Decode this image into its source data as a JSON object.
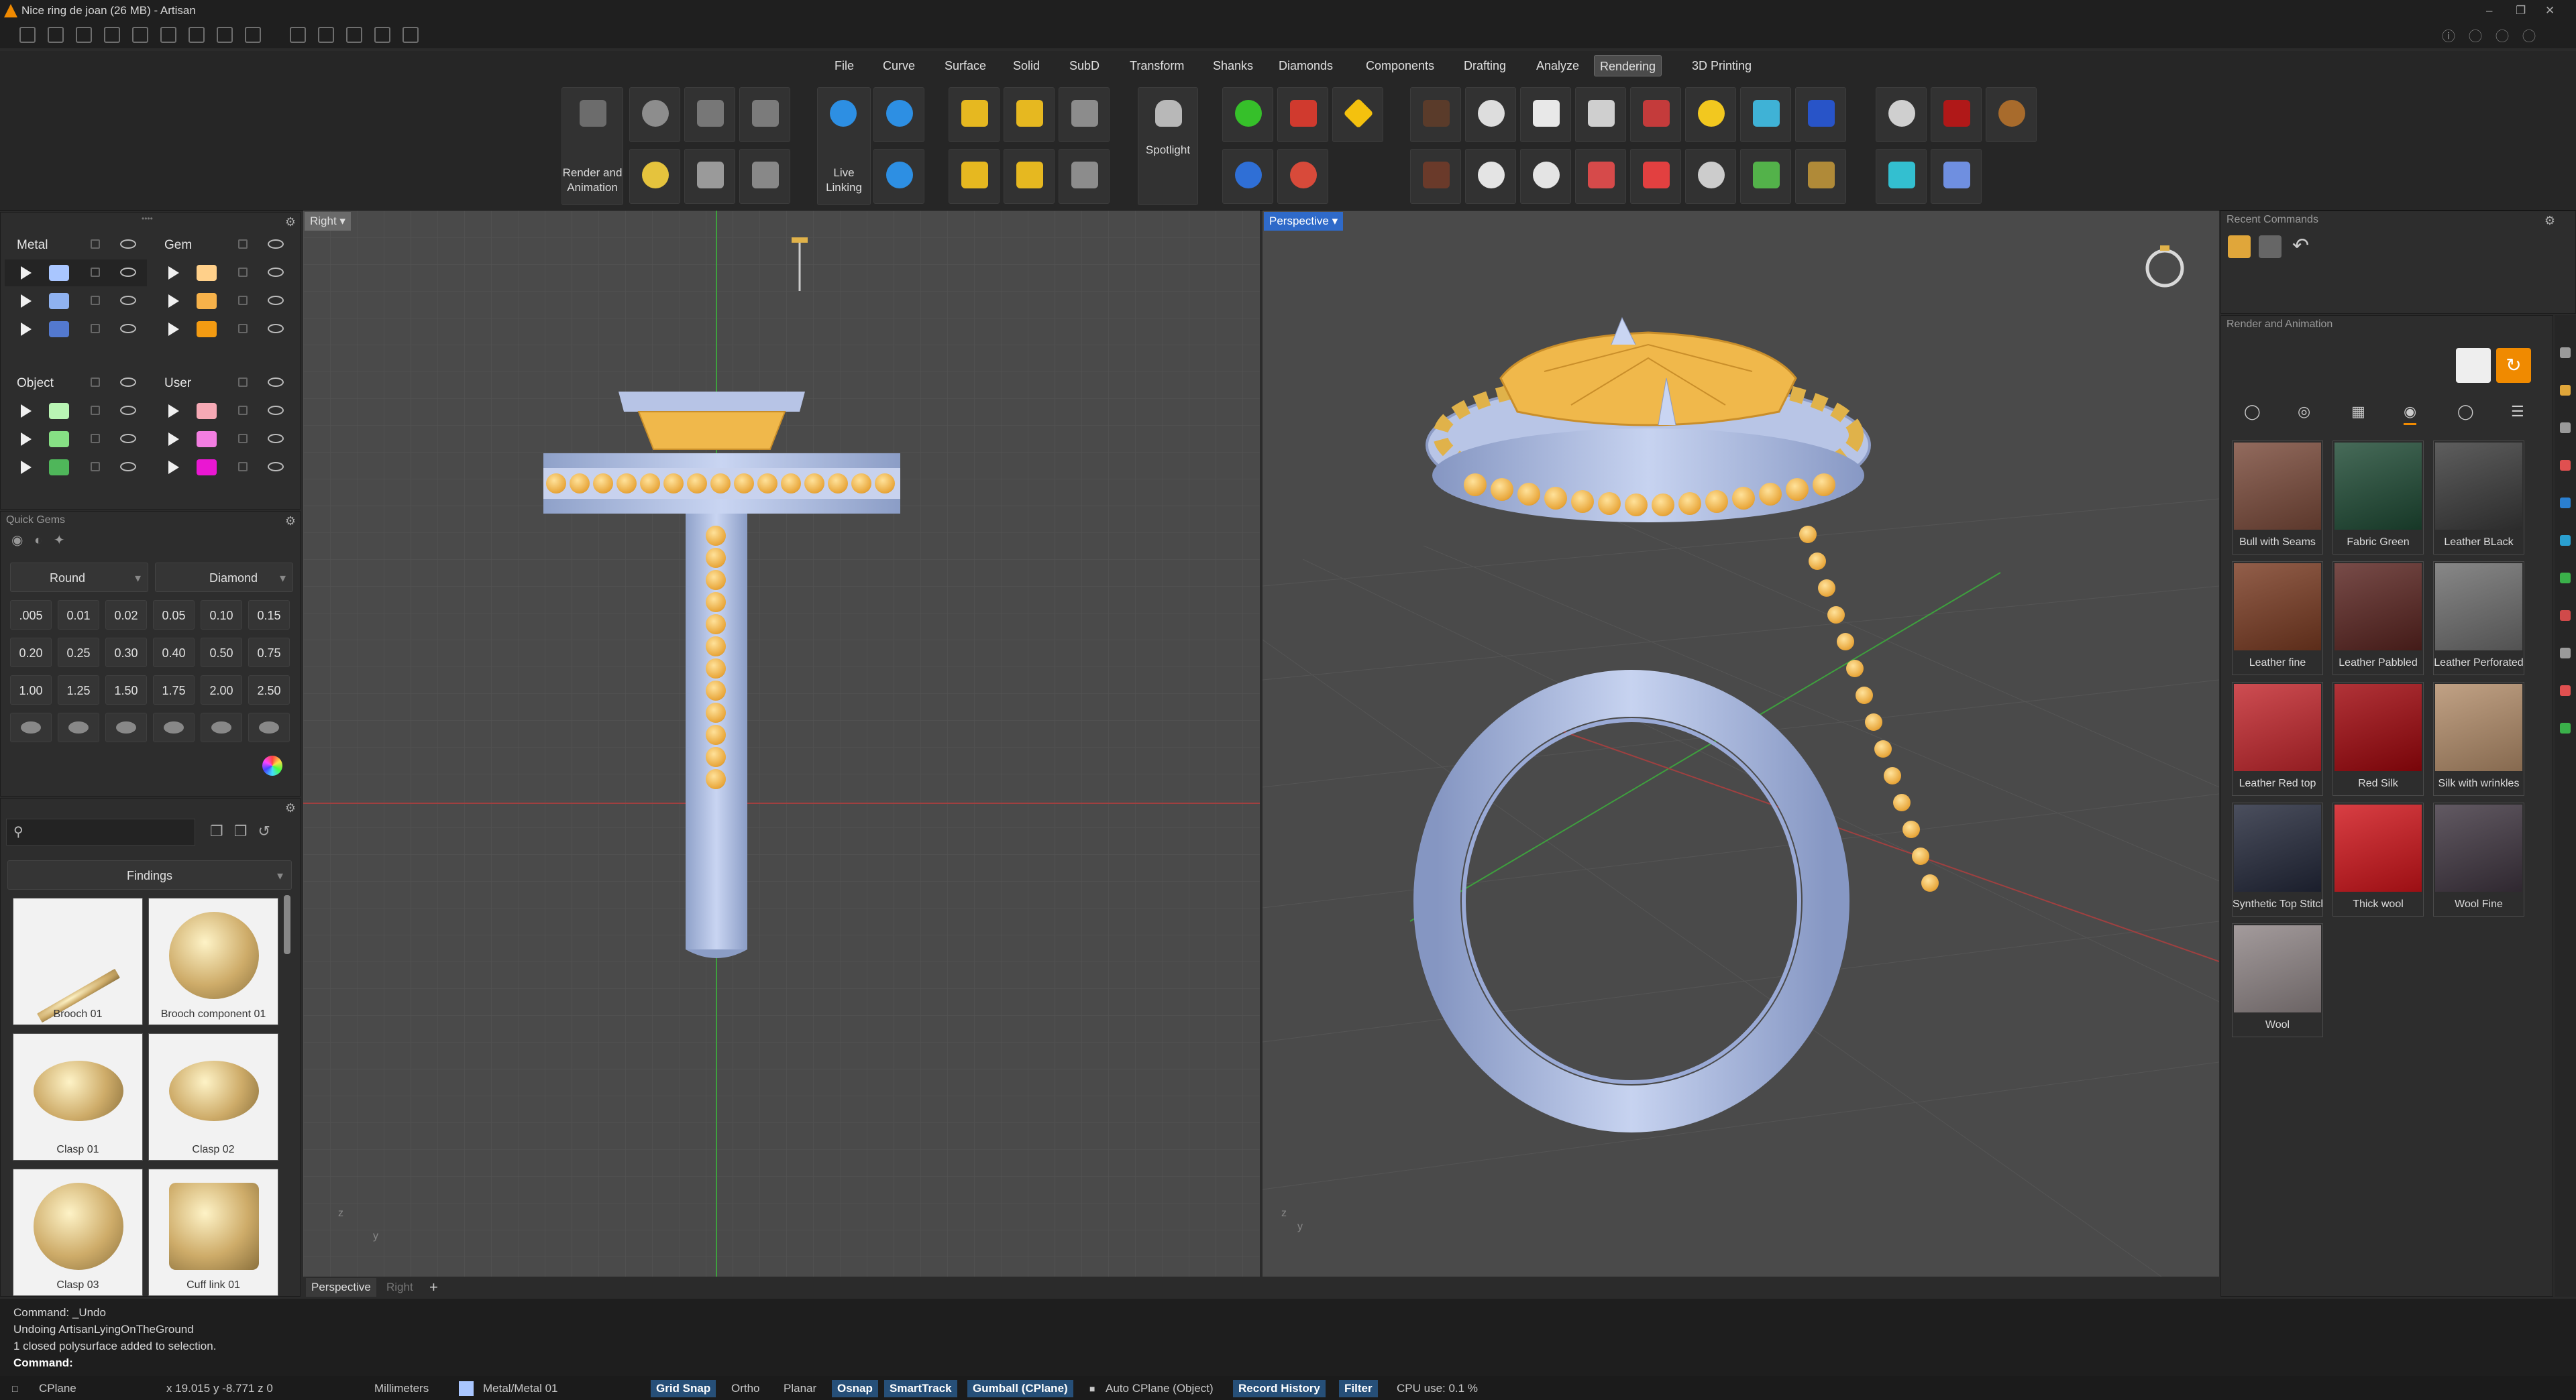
{
  "window": {
    "title": "Nice ring de joan (26 MB) - Artisan"
  },
  "menu": [
    "File",
    "Curve",
    "Surface",
    "Solid",
    "SubD",
    "Transform",
    "Shanks",
    "Diamonds",
    "Components",
    "Drafting",
    "Analyze",
    "Rendering",
    "3D Printing"
  ],
  "ribbon": {
    "render_label": "Render and Animation",
    "live_label": "Live Linking",
    "spot_label": "Spotlight"
  },
  "layers": {
    "metal": "Metal",
    "gem": "Gem",
    "object": "Object",
    "user": "User",
    "colors": {
      "metal": [
        "#a9c6ff",
        "#8fb2f0",
        "#5379cf"
      ],
      "gem": [
        "#ffd08a",
        "#f7b24a",
        "#f39b12"
      ],
      "object": [
        "#b9f5b4",
        "#86df84",
        "#4fb65a"
      ],
      "user": [
        "#f6a9b5",
        "#f27ee1",
        "#ea17d2"
      ]
    }
  },
  "quickgems": {
    "title": "Quick Gems",
    "shape": "Round",
    "material": "Diamond",
    "sizes": [
      ".005",
      "0.01",
      "0.02",
      "0.05",
      "0.10",
      "0.15",
      "0.20",
      "0.25",
      "0.30",
      "0.40",
      "0.50",
      "0.75",
      "1.00",
      "1.25",
      "1.50",
      "1.75",
      "2.00",
      "2.50"
    ]
  },
  "library": {
    "category": "Findings",
    "items": [
      "Brooch 01",
      "Brooch component 01",
      "Clasp 01",
      "Clasp 02",
      "Clasp 03",
      "Cuff link 01"
    ]
  },
  "viewports": {
    "left": "Right",
    "right": "Perspective",
    "tabs": [
      "Perspective",
      "Right"
    ],
    "add_tab": "+"
  },
  "right_panel": {
    "recent": "Recent Commands",
    "render": "Render and Animation",
    "materials": [
      {
        "name": "Bull with Seams",
        "color": "#7a4a3a"
      },
      {
        "name": "Fabric Green",
        "color": "#1e4a34"
      },
      {
        "name": "Leather BLack",
        "color": "#3a3a3a"
      },
      {
        "name": "Leather fine",
        "color": "#7a3b22"
      },
      {
        "name": "Leather Pabbled",
        "color": "#5a2420"
      },
      {
        "name": "Leather Perforated",
        "color": "#6d6d6d"
      },
      {
        "name": "Leather Red top",
        "color": "#c3262c"
      },
      {
        "name": "Red Silk",
        "color": "#a0060c"
      },
      {
        "name": "Silk with wrinkles",
        "color": "#b38d6a"
      },
      {
        "name": "Synthetic Top Stitch",
        "color": "#23283a"
      },
      {
        "name": "Thick wool",
        "color": "#d0141a"
      },
      {
        "name": "Wool Fine",
        "color": "#3f3540"
      },
      {
        "name": "Wool",
        "color": "#8f8586"
      }
    ]
  },
  "command": {
    "lines": [
      "Command: _Undo",
      "Undoing ArtisanLyingOnTheGround",
      "1 closed polysurface added to selection."
    ],
    "prompt": "Command:"
  },
  "status": {
    "cplane": "CPlane",
    "coords": "x 19.015  y -8.771  z 0",
    "units": "Millimeters",
    "layer": "Metal/Metal 01",
    "grid": "Grid Snap",
    "ortho": "Ortho",
    "planar": "Planar",
    "osnap": "Osnap",
    "smarttrack": "SmartTrack",
    "gumball": "Gumball (CPlane)",
    "autocp": "Auto CPlane (Object)",
    "record": "Record History",
    "filter": "Filter",
    "cpu": "CPU use: 0.1 %"
  }
}
